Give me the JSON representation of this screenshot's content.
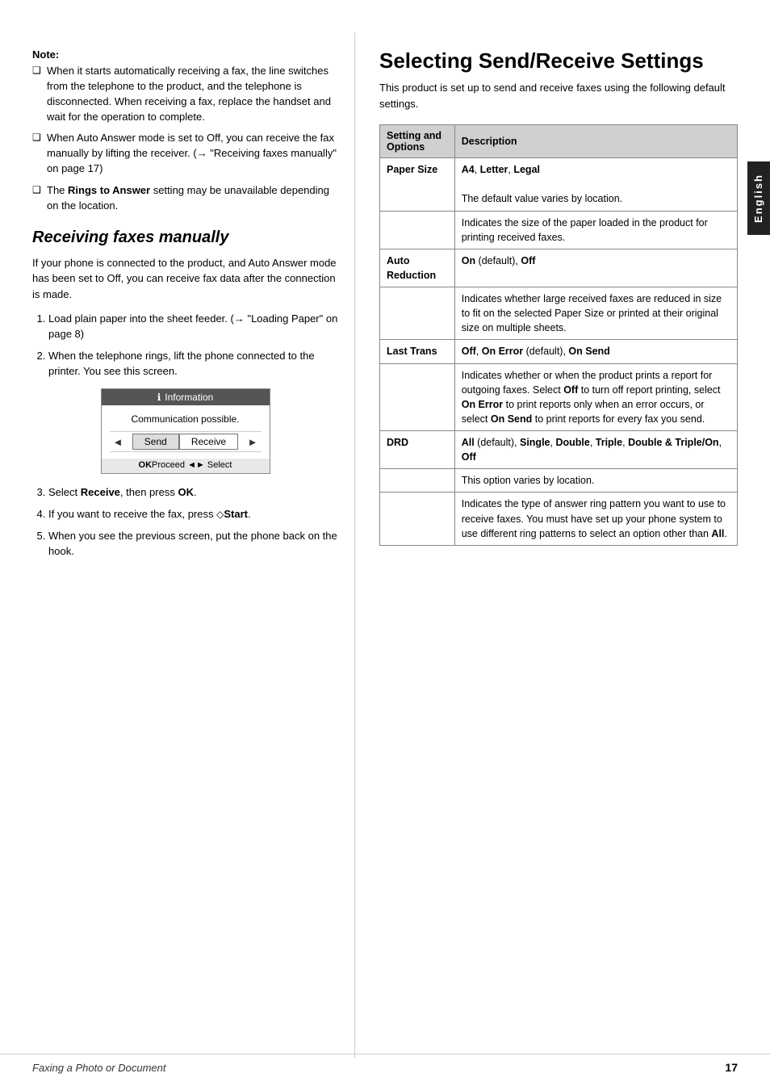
{
  "note": {
    "label": "Note:",
    "items": [
      "When it starts automatically receiving a fax, the line switches from the telephone to the product, and the telephone is disconnected. When receiving a fax, replace the handset and wait for the operation to complete.",
      "When Auto Answer mode is set to Off, you can receive the fax manually by lifting the receiver. (→ \"Receiving faxes manually\" on page 17)",
      "The Rings to Answer setting may be unavailable depending on the location."
    ],
    "item2_prefix": "When Auto Answer mode is set to Off, you can receive the fax manually by lifting the receiver. (",
    "item2_arrow": "→",
    "item2_link": "\"Receiving faxes manually\"",
    "item2_suffix": " on page 17)",
    "item3_prefix": "The ",
    "item3_bold": "Rings to Answer",
    "item3_suffix": " setting may be unavailable depending on the location."
  },
  "section": {
    "heading": "Receiving faxes manually",
    "body": "If your phone is connected to the product, and Auto Answer mode has been set to Off, you can receive fax data after the connection is made.",
    "steps": [
      {
        "num": 1,
        "text": "Load plain paper into the sheet feeder. (→ \"Loading Paper\" on page 8)"
      },
      {
        "num": 2,
        "text": "When the telephone rings, lift the phone connected to the printer. You see this screen."
      },
      {
        "num": 3,
        "text_prefix": "Select ",
        "text_bold": "Receive",
        "text_suffix": ", then press ",
        "text_bold2": "OK",
        "text_end": "."
      },
      {
        "num": 4,
        "text_prefix": "If you want to receive the fax, press ",
        "text_diamond": "◇",
        "text_bold": "Start",
        "text_suffix": "."
      },
      {
        "num": 5,
        "text": "When you see the previous screen, put the phone back on the hook."
      }
    ],
    "device": {
      "titlebar_icon": "ℹ",
      "titlebar_text": "Information",
      "comm_text": "Communication possible.",
      "nav_left": "◄",
      "nav_right": "►",
      "btn_send": "Send",
      "btn_receive": "Receive",
      "footer_ok": "OK",
      "footer_proceed": "Proceed",
      "footer_select_icon": "◄►",
      "footer_select": "Select"
    }
  },
  "right_section": {
    "heading": "Selecting Send/Receive Settings",
    "intro": "This product is set up to send and receive faxes using the following default settings.",
    "table": {
      "col1": "Setting and Options",
      "col2": "Description",
      "rows": [
        {
          "setting": "Paper Size",
          "values": "A4, Letter, Legal",
          "desc1": "The default value varies by location.",
          "desc2": "Indicates the size of the paper loaded in the product for printing received faxes."
        },
        {
          "setting": "Auto Reduction",
          "values": "On (default), Off",
          "desc1": "Indicates whether large received faxes are reduced in size to fit on the selected Paper Size or printed at their original size on multiple sheets."
        },
        {
          "setting": "Last Trans",
          "values": "Off, On Error (default), On Send",
          "desc1": "Indicates whether or when the product prints a report for outgoing faxes. Select Off to turn off report printing, select On Error to print reports only when an error occurs, or select On Send to print reports for every fax you send."
        },
        {
          "setting": "DRD",
          "values": "All (default), Single, Double, Triple, Double & Triple/On, Off",
          "desc1": "This option varies by location.",
          "desc2": "Indicates the type of answer ring pattern you want to use to receive faxes. You must have set up your phone system to use different ring patterns to select an option other than All."
        }
      ]
    }
  },
  "footer": {
    "left": "Faxing a Photo or Document",
    "right": "17"
  }
}
